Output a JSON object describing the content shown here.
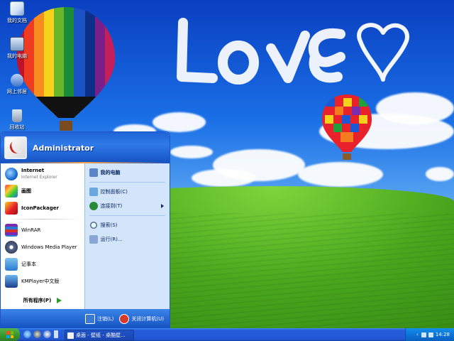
{
  "desktop": {
    "icons": [
      {
        "label": "我的文档",
        "icon": "my-documents-icon"
      },
      {
        "label": "我的电脑",
        "icon": "my-computer-icon"
      },
      {
        "label": "网上邻居",
        "icon": "network-places-icon"
      },
      {
        "label": "回收站",
        "icon": "recycle-bin-icon"
      }
    ]
  },
  "start_menu": {
    "user_name": "Administrator",
    "pinned": [
      {
        "title": "Internet",
        "subtitle": "Internet Explorer",
        "icon": "internet-explorer-icon"
      },
      {
        "title": "画图",
        "icon": "paint-icon"
      },
      {
        "title": "IconPackager",
        "icon": "iconpackager-icon"
      }
    ],
    "recent": [
      {
        "title": "WinRAR",
        "icon": "winrar-icon"
      },
      {
        "title": "Windows Media Player",
        "icon": "media-player-icon"
      },
      {
        "title": "记事本",
        "icon": "notepad-icon"
      },
      {
        "title": "KMPlayer中文版",
        "icon": "kmplayer-icon"
      }
    ],
    "all_programs": "所有程序(P)",
    "right": [
      {
        "label": "我的电脑",
        "icon": "my-computer-icon",
        "bold": true
      },
      {
        "label": "控制面板(C)",
        "icon": "control-panel-icon"
      },
      {
        "label": "连接到(T)",
        "icon": "connect-to-icon",
        "submenu": true
      },
      {
        "label": "搜索(S)",
        "icon": "search-icon"
      },
      {
        "label": "运行(R)...",
        "icon": "run-icon"
      }
    ],
    "logoff": "注销(L)",
    "shutdown": "关闭计算机(U)"
  },
  "taskbar": {
    "task_button": "桌面 - 壁纸 - 桌酷壁...",
    "clock": "14:28"
  },
  "colors": {
    "start_menu_blue": "#1d63d6",
    "right_pane": "#d3e5fa",
    "start_button_green": "#3a9a2f",
    "taskbar_blue": "#2257d5"
  }
}
